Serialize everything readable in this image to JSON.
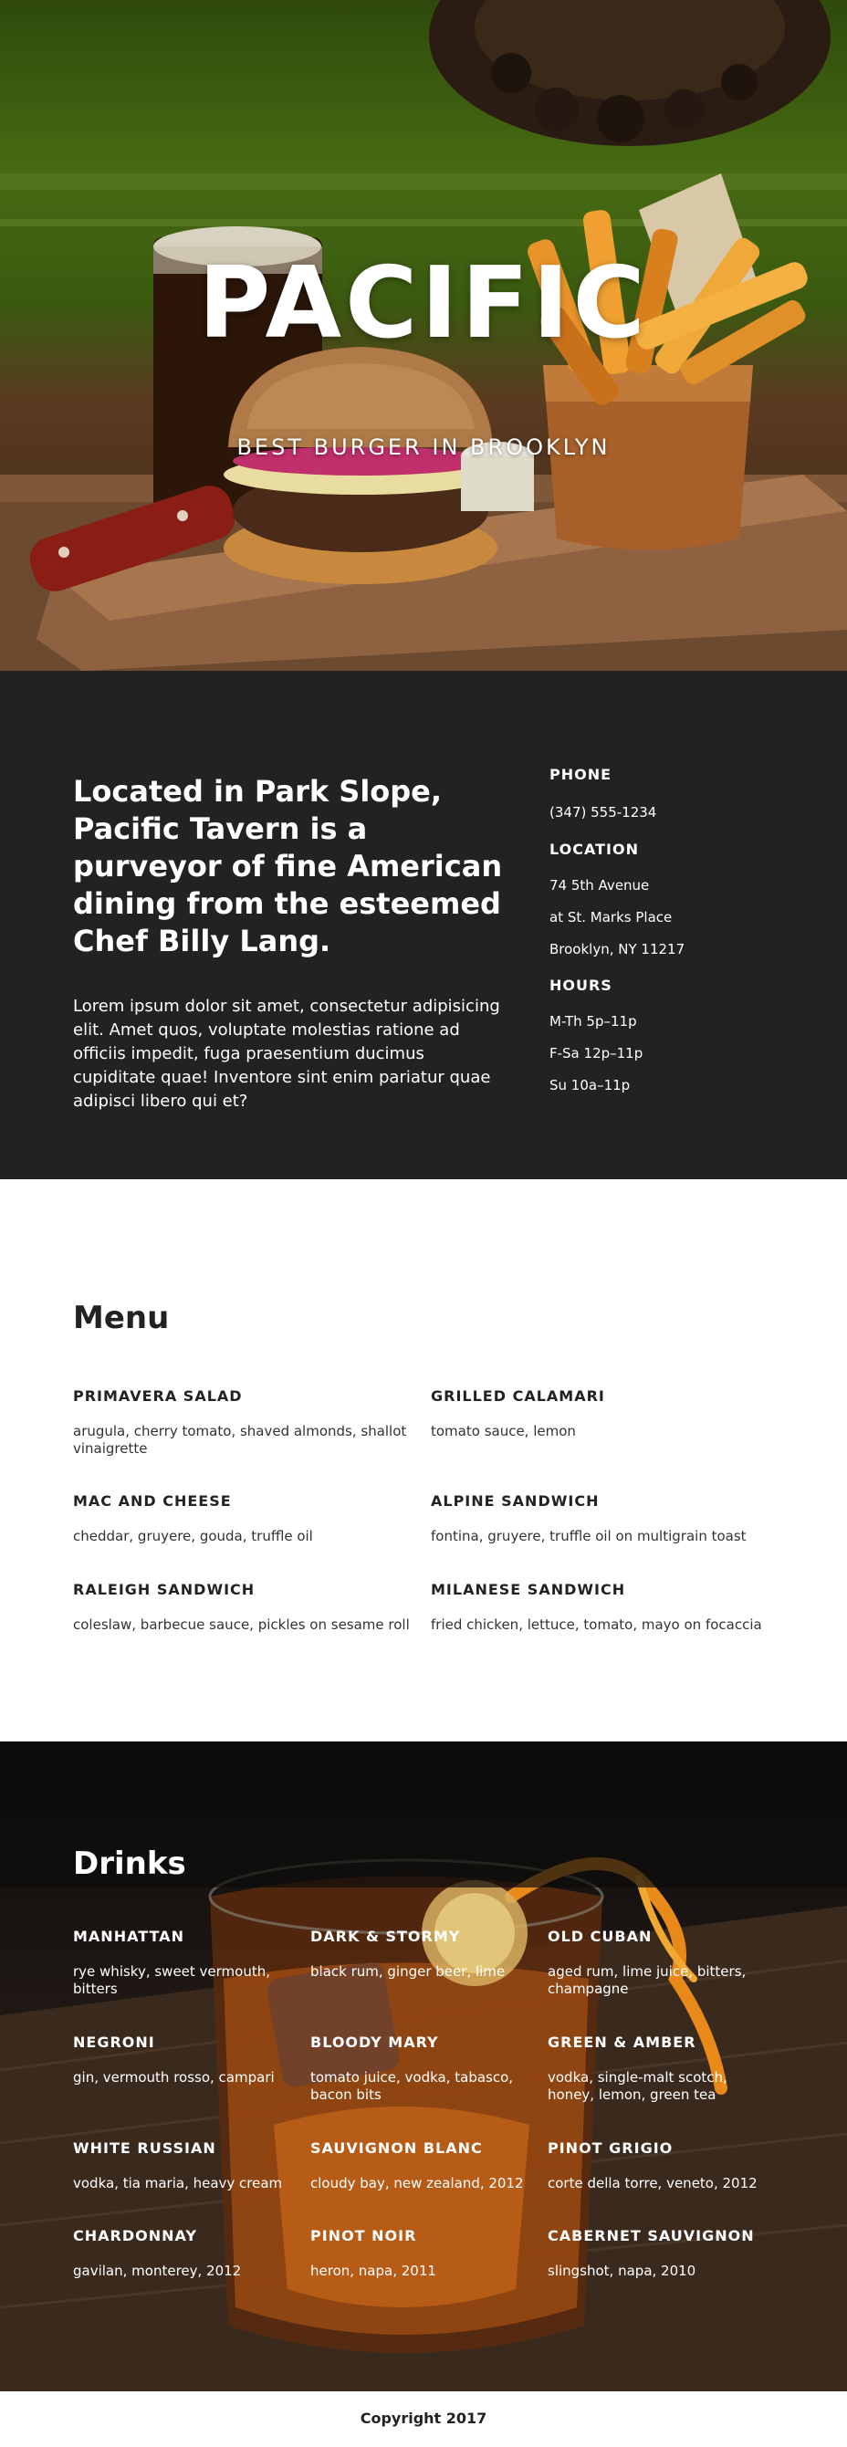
{
  "hero": {
    "title": "PACIFIC",
    "subtitle": "BEST BURGER IN BROOKLYN"
  },
  "about": {
    "heading": "Located in Park Slope, Pacific Tavern is a purveyor of fine American dining from the esteemed Chef Billy Lang.",
    "text": "Lorem ipsum dolor sit amet, consectetur adipisicing elit. Amet quos, voluptate molestias ratione ad officiis impedit, fuga praesentium ducimus cupiditate quae! Inventore sint enim pariatur quae adipisci libero qui et?",
    "phone_label": "PHONE",
    "phone": "(347) 555-1234",
    "location_label": "LOCATION",
    "location_lines": [
      "74 5th Avenue",
      "at St. Marks Place",
      "Brooklyn, NY 11217"
    ],
    "hours_label": "HOURS",
    "hours_lines": [
      "M-Th 5p–11p",
      "F-Sa 12p–11p",
      "Su 10a–11p"
    ]
  },
  "menu": {
    "title": "Menu",
    "items": [
      {
        "name": "PRIMAVERA SALAD",
        "desc": "arugula, cherry tomato, shaved almonds, shallot vinaigrette"
      },
      {
        "name": "GRILLED CALAMARI",
        "desc": "tomato sauce, lemon"
      },
      {
        "name": "MAC AND CHEESE",
        "desc": "cheddar, gruyere, gouda, truffle oil"
      },
      {
        "name": "ALPINE SANDWICH",
        "desc": "fontina, gruyere, truffle oil on multigrain toast"
      },
      {
        "name": "RALEIGH SANDWICH",
        "desc": "coleslaw, barbecue sauce, pickles on sesame roll"
      },
      {
        "name": "MILANESE SANDWICH",
        "desc": "fried chicken, lettuce, tomato, mayo on focaccia"
      }
    ]
  },
  "drinks": {
    "title": "Drinks",
    "items": [
      {
        "name": "MANHATTAN",
        "desc": "rye whisky, sweet vermouth, bitters"
      },
      {
        "name": "DARK & STORMY",
        "desc": "black rum, ginger beer, lime"
      },
      {
        "name": "OLD CUBAN",
        "desc": "aged rum, lime juice, bitters, champagne"
      },
      {
        "name": "NEGRONI",
        "desc": "gin, vermouth rosso, campari"
      },
      {
        "name": "BLOODY MARY",
        "desc": "tomato juice, vodka, tabasco, bacon bits"
      },
      {
        "name": "GREEN & AMBER",
        "desc": "vodka, single-malt scotch, honey, lemon, green tea"
      },
      {
        "name": "WHITE RUSSIAN",
        "desc": "vodka, tia maria, heavy cream"
      },
      {
        "name": "SAUVIGNON BLANC",
        "desc": "cloudy bay, new zealand, 2012"
      },
      {
        "name": "PINOT GRIGIO",
        "desc": "corte della torre, veneto, 2012"
      },
      {
        "name": "CHARDONNAY",
        "desc": "gavilan, monterey, 2012"
      },
      {
        "name": "PINOT NOIR",
        "desc": "heron, napa, 2011"
      },
      {
        "name": "CABERNET SAUVIGNON",
        "desc": "slingshot, napa, 2010"
      }
    ]
  },
  "footer": {
    "copyright": "Copyright 2017"
  },
  "colors": {
    "dark_section": "#222222",
    "hero_wall_green": "#466b12",
    "text_light": "#ffffff",
    "text_dark": "#222222"
  }
}
